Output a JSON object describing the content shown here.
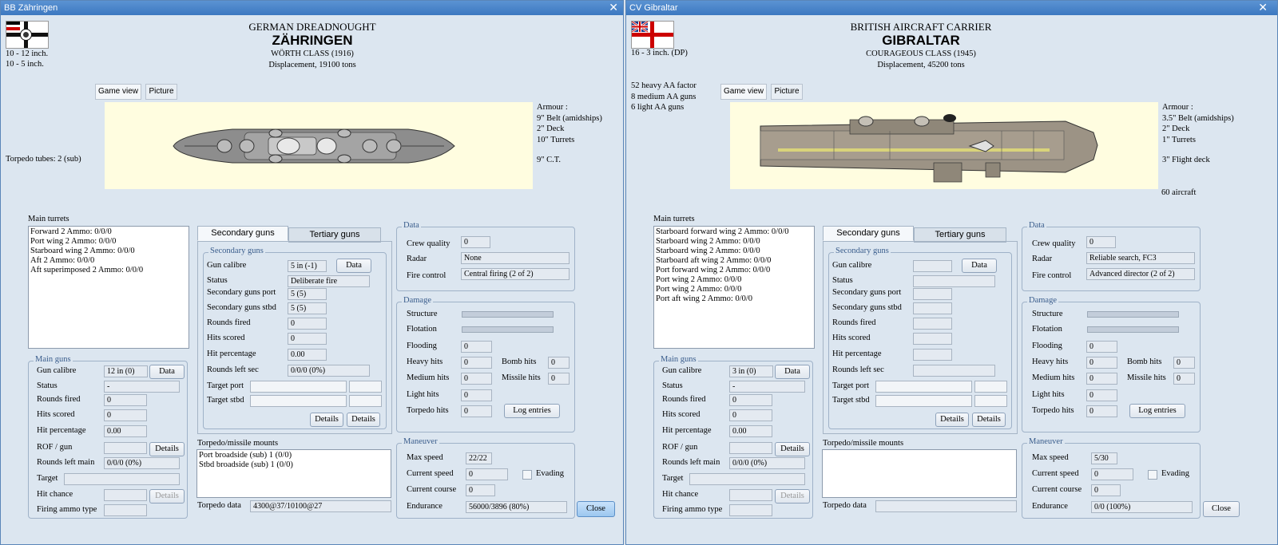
{
  "left": {
    "title": "BB Zähringen",
    "header": {
      "type": "GERMAN DREADNOUGHT",
      "name": "ZÄHRINGEN",
      "class": "WÖRTH CLASS (1916)",
      "displacement": "Displacement, 19100 tons"
    },
    "armament": [
      "10 - 12 inch.",
      "10 - 5 inch."
    ],
    "torpedo_tubes": "Torpedo tubes: 2 (sub)",
    "image_tabs": [
      "Game view",
      "Picture"
    ],
    "armour": {
      "title": "Armour :",
      "lines": [
        "9\" Belt (amidships)",
        "2\" Deck",
        "10\" Turrets"
      ],
      "ct": "9\" C.T."
    },
    "main_turrets": {
      "label": "Main turrets",
      "items": [
        "Forward 2 Ammo: 0/0/0",
        "Port wing 2 Ammo: 0/0/0",
        "Starboard wing 2 Ammo: 0/0/0",
        "Aft 2 Ammo: 0/0/0",
        "Aft superimposed 2 Ammo: 0/0/0"
      ]
    },
    "main_guns": {
      "label": "Main guns",
      "gun_calibre": "Gun calibre",
      "gun_calibre_val": "12 in (0)",
      "data_btn": "Data",
      "status": "Status",
      "status_val": "-",
      "rounds_fired": "Rounds fired",
      "rounds_fired_val": "0",
      "hits_scored": "Hits scored",
      "hits_scored_val": "0",
      "hit_percentage": "Hit percentage",
      "hit_percentage_val": "0.00",
      "rof": "ROF / gun",
      "rof_val": "",
      "details_btn": "Details",
      "rounds_left": "Rounds left main",
      "rounds_left_val": "0/0/0 (0%)",
      "target": "Target",
      "target_val": "",
      "hit_chance": "Hit chance",
      "hit_chance_val": "",
      "details_btn2": "Details",
      "firing_ammo": "Firing ammo type",
      "firing_ammo_val": ""
    },
    "tabs": {
      "secondary": "Secondary guns",
      "tertiary": "Tertiary guns"
    },
    "secondary": {
      "label": "Secondary guns",
      "gun_calibre": "Gun calibre",
      "gun_calibre_val": "5 in (-1)",
      "data_btn": "Data",
      "status": "Status",
      "status_val": "Deliberate fire",
      "port": "Secondary guns port",
      "port_val": "5 (5)",
      "stbd": "Secondary guns stbd",
      "stbd_val": "5 (5)",
      "rounds_fired": "Rounds fired",
      "rounds_fired_val": "0",
      "hits_scored": "Hits scored",
      "hits_scored_val": "0",
      "hit_percentage": "Hit percentage",
      "hit_percentage_val": "0.00",
      "rounds_left": "Rounds left sec",
      "rounds_left_val": "0/0/0 (0%)",
      "target_port": "Target port",
      "target_stbd": "Target stbd",
      "details1": "Details",
      "details2": "Details"
    },
    "torpedo": {
      "label": "Torpedo/missile mounts",
      "items": [
        "Port broadside (sub) 1 (0/0)",
        "Stbd broadside (sub) 1 (0/0)"
      ],
      "data_label": "Torpedo data",
      "data_val": "4300@37/10100@27"
    },
    "data": {
      "label": "Data",
      "crew": "Crew quality",
      "crew_val": "0",
      "radar": "Radar",
      "radar_val": "None",
      "fire": "Fire control",
      "fire_val": "Central firing (2 of 2)"
    },
    "damage": {
      "label": "Damage",
      "structure": "Structure",
      "flotation": "Flotation",
      "flooding": "Flooding",
      "flooding_val": "0",
      "heavy": "Heavy hits",
      "heavy_val": "0",
      "bomb": "Bomb hits",
      "bomb_val": "0",
      "medium": "Medium hits",
      "medium_val": "0",
      "missile": "Missile hits",
      "missile_val": "0",
      "light": "Light hits",
      "light_val": "0",
      "torpedo": "Torpedo hits",
      "torpedo_val": "0",
      "log_btn": "Log entries"
    },
    "maneuver": {
      "label": "Maneuver",
      "max_speed": "Max speed",
      "max_speed_val": "22/22",
      "cur_speed": "Current speed",
      "cur_speed_val": "0",
      "evading": "Evading",
      "cur_course": "Current course",
      "cur_course_val": "0",
      "endurance": "Endurance",
      "endurance_val": "56000/3896 (80%)"
    },
    "close_btn": "Close"
  },
  "right": {
    "title": "CV Gibraltar",
    "header": {
      "type": "BRITISH AIRCRAFT CARRIER",
      "name": "GIBRALTAR",
      "class": "COURAGEOUS CLASS (1945)",
      "displacement": "Displacement, 45200 tons"
    },
    "armament": [
      "16 - 3 inch. (DP)"
    ],
    "aa": [
      "52 heavy AA factor",
      "8 medium AA guns",
      "6 light AA guns"
    ],
    "image_tabs": [
      "Game view",
      "Picture"
    ],
    "armour": {
      "title": "Armour :",
      "lines": [
        "3.5\" Belt (amidships)",
        "2\" Deck",
        "1\" Turrets"
      ],
      "flight": "3\" Flight deck",
      "aircraft": "60 aircraft"
    },
    "main_turrets": {
      "label": "Main turrets",
      "items": [
        "Starboard forward wing 2 Ammo: 0/0/0",
        "Starboard wing 2 Ammo: 0/0/0",
        "Starboard wing 2 Ammo: 0/0/0",
        "Starboard aft wing 2 Ammo: 0/0/0",
        "Port forward wing 2 Ammo: 0/0/0",
        "Port wing 2 Ammo: 0/0/0",
        "Port wing 2 Ammo: 0/0/0",
        "Port aft wing 2 Ammo: 0/0/0"
      ]
    },
    "main_guns": {
      "label": "Main guns",
      "gun_calibre": "Gun calibre",
      "gun_calibre_val": "3 in (0)",
      "data_btn": "Data",
      "status": "Status",
      "status_val": "-",
      "rounds_fired": "Rounds fired",
      "rounds_fired_val": "0",
      "hits_scored": "Hits scored",
      "hits_scored_val": "0",
      "hit_percentage": "Hit percentage",
      "hit_percentage_val": "0.00",
      "rof": "ROF / gun",
      "rof_val": "",
      "details_btn": "Details",
      "rounds_left": "Rounds left main",
      "rounds_left_val": "0/0/0 (0%)",
      "target": "Target",
      "target_val": "",
      "hit_chance": "Hit chance",
      "hit_chance_val": "",
      "details_btn2": "Details",
      "firing_ammo": "Firing ammo type",
      "firing_ammo_val": ""
    },
    "tabs": {
      "secondary": "Secondary guns",
      "tertiary": "Tertiary guns"
    },
    "secondary": {
      "label": "Secondary guns",
      "gun_calibre": "Gun calibre",
      "gun_calibre_val": "",
      "data_btn": "Data",
      "status": "Status",
      "status_val": "",
      "port": "Secondary guns port",
      "port_val": "",
      "stbd": "Secondary guns stbd",
      "stbd_val": "",
      "rounds_fired": "Rounds fired",
      "rounds_fired_val": "",
      "hits_scored": "Hits scored",
      "hits_scored_val": "",
      "hit_percentage": "Hit percentage",
      "hit_percentage_val": "",
      "rounds_left": "Rounds left sec",
      "rounds_left_val": "",
      "target_port": "Target port",
      "target_stbd": "Target stbd",
      "details1": "Details",
      "details2": "Details"
    },
    "torpedo": {
      "label": "Torpedo/missile mounts",
      "items": [],
      "data_label": "Torpedo data",
      "data_val": ""
    },
    "data": {
      "label": "Data",
      "crew": "Crew quality",
      "crew_val": "0",
      "radar": "Radar",
      "radar_val": "Reliable search, FC3",
      "fire": "Fire control",
      "fire_val": "Advanced director (2 of 2)"
    },
    "damage": {
      "label": "Damage",
      "structure": "Structure",
      "flotation": "Flotation",
      "flooding": "Flooding",
      "flooding_val": "0",
      "heavy": "Heavy hits",
      "heavy_val": "0",
      "bomb": "Bomb hits",
      "bomb_val": "0",
      "medium": "Medium hits",
      "medium_val": "0",
      "missile": "Missile hits",
      "missile_val": "0",
      "light": "Light hits",
      "light_val": "0",
      "torpedo": "Torpedo hits",
      "torpedo_val": "0",
      "log_btn": "Log entries"
    },
    "maneuver": {
      "label": "Maneuver",
      "max_speed": "Max speed",
      "max_speed_val": "5/30",
      "cur_speed": "Current speed",
      "cur_speed_val": "0",
      "evading": "Evading",
      "cur_course": "Current course",
      "cur_course_val": "0",
      "endurance": "Endurance",
      "endurance_val": "0/0 (100%)"
    },
    "close_btn": "Close"
  }
}
